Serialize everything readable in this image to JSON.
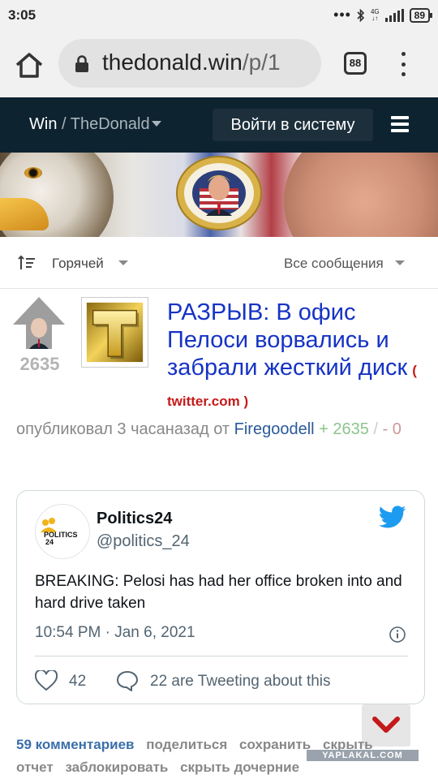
{
  "status_bar": {
    "time": "3:05",
    "network": "4G",
    "battery": "89"
  },
  "browser": {
    "url_host": "thedonald.win",
    "url_path": "/p/1",
    "tab_count": "88"
  },
  "site_nav": {
    "brand": "Win",
    "separator": " / ",
    "community": "TheDonald",
    "login_label": "Войти в систему"
  },
  "sort_bar": {
    "sort_label": "Горячей",
    "filter_label": "Все сообщения"
  },
  "post": {
    "score": "2635",
    "title": "РАЗРЫВ: В офис Пелоси ворвались и забрали жесткий диск",
    "domain": "( twitter.com )",
    "meta_prefix": "опубликовал 3 часаназад от ",
    "author": "Firegoodell",
    "plus": " + 2635",
    "slash": " / ",
    "minus": " - 0"
  },
  "tweet": {
    "name": "Politics24",
    "handle": "@politics_24",
    "avatar_text": "POLITICS 24",
    "text": "BREAKING: Pelosi has had her office broken into and hard drive taken",
    "timestamp": "10:54 PM · Jan 6, 2021",
    "likes": "42",
    "replies": "22 are Tweeting about this"
  },
  "actions": {
    "comments": "59 комментариев",
    "share": "поделиться",
    "save": "сохранить",
    "hide": "скрыть",
    "report": "отчет",
    "block": "заблокировать",
    "hide_children": "скрыть дочерние"
  },
  "watermark": "YAPLAKAL.COM",
  "colors": {
    "nav_bg": "#0e2330",
    "link_blue": "#1633c4",
    "domain_red": "#c41a1a",
    "twitter_blue": "#1d9bf0"
  }
}
